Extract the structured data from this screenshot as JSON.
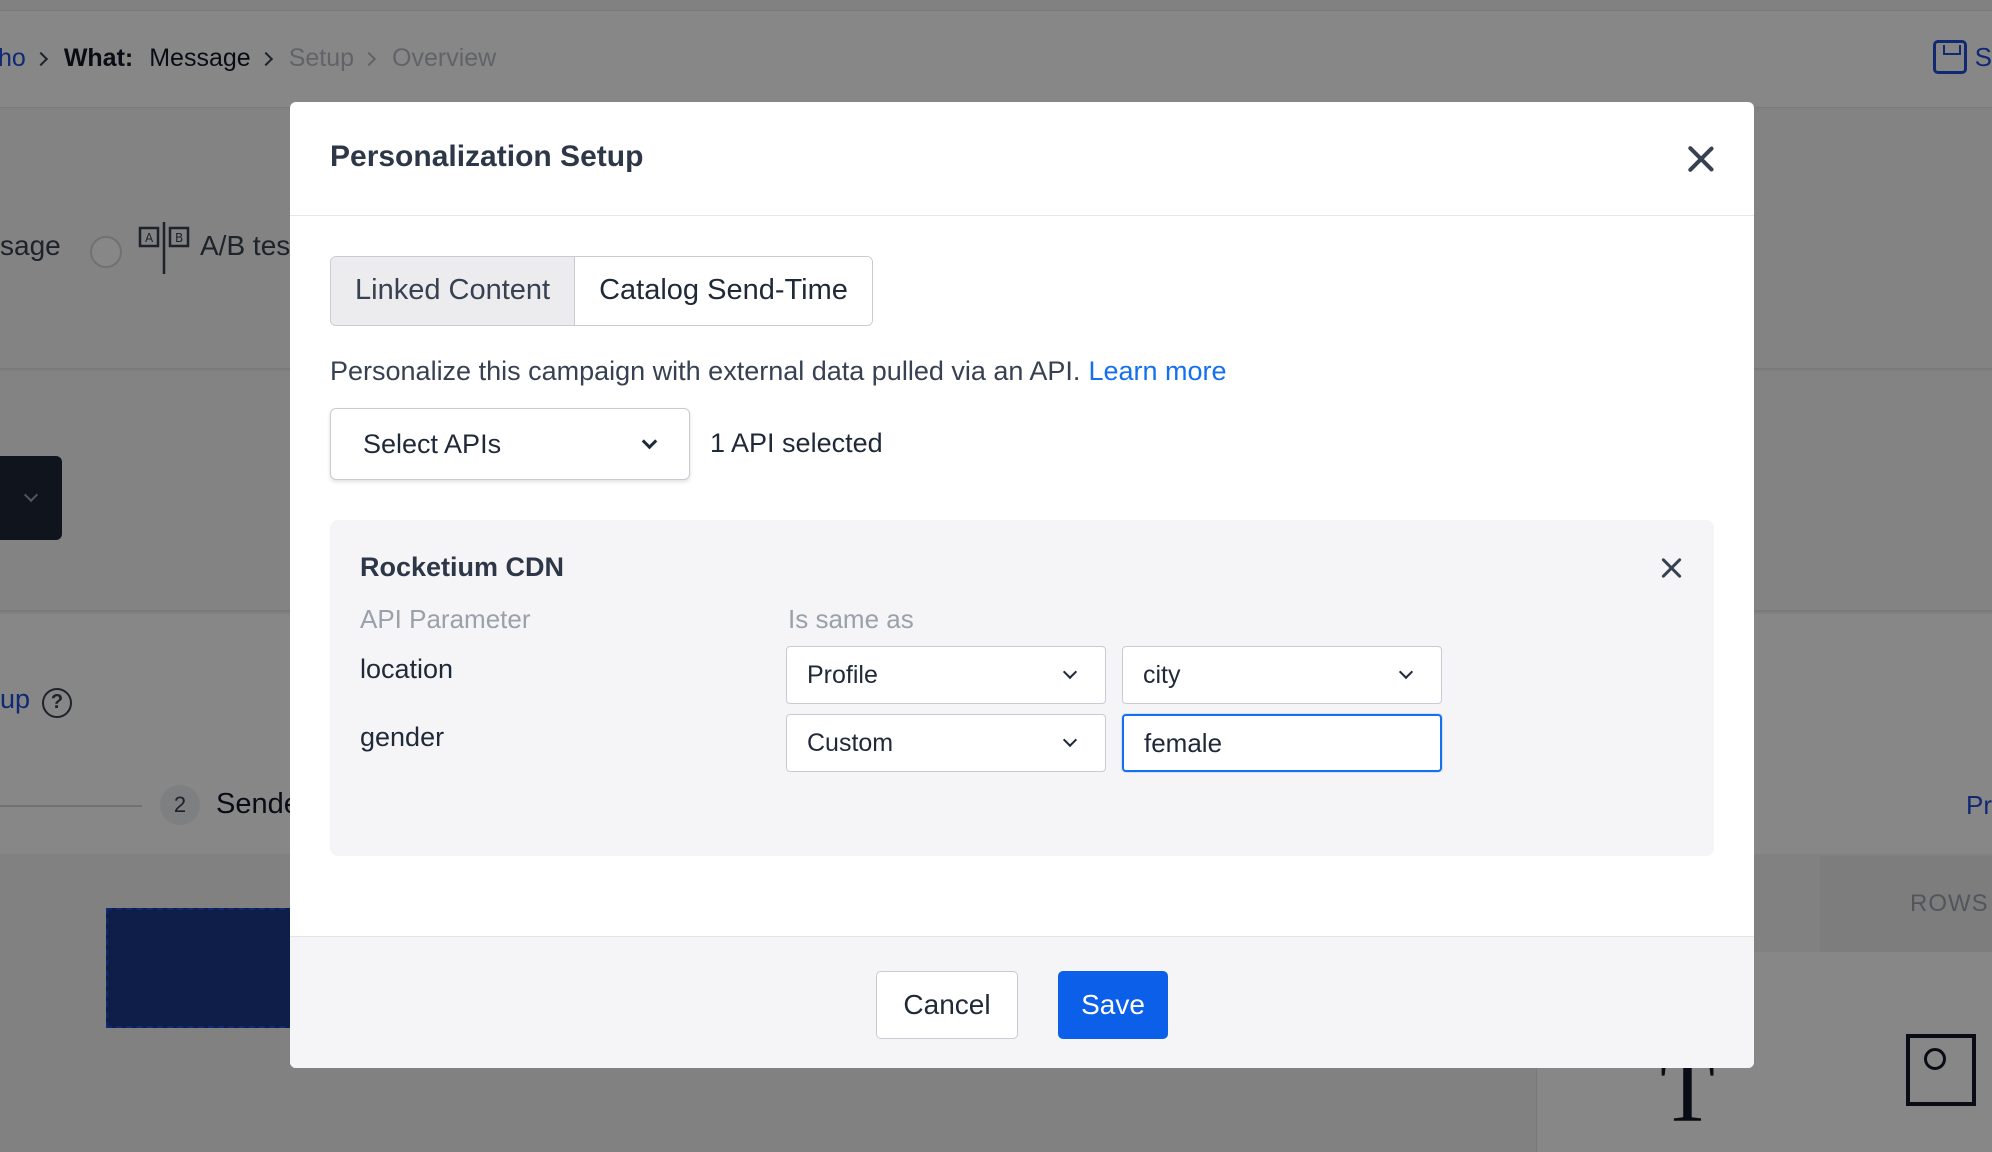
{
  "background": {
    "breadcrumb": {
      "who": "ho",
      "what_label": "What:",
      "what_value": "Message",
      "setup": "Setup",
      "overview": "Overview"
    },
    "save_partial": "S",
    "message_tab": "sage",
    "ab_test": "A/B tes",
    "setup_link": "up",
    "help_icon": "?",
    "step_number": "2",
    "step_label": "Sende",
    "preview_partial": "Pr",
    "rows_label": "ROWS",
    "text_glyph": "T"
  },
  "modal": {
    "title": "Personalization Setup",
    "tabs": [
      {
        "label": "Linked Content",
        "active": true
      },
      {
        "label": "Catalog Send-Time",
        "active": false
      }
    ],
    "description": "Personalize this campaign with external data pulled via an API.",
    "learn_more": "Learn more",
    "select_apis": {
      "label": "Select APIs"
    },
    "api_count": "1 API selected",
    "api_card": {
      "title": "Rocketium CDN",
      "col_param": "API Parameter",
      "col_same_as": "Is same as",
      "rows": [
        {
          "param": "location",
          "source": "Profile",
          "value": "city",
          "value_type": "dropdown"
        },
        {
          "param": "gender",
          "source": "Custom",
          "value": "female",
          "value_type": "input"
        }
      ]
    },
    "footer": {
      "cancel": "Cancel",
      "save": "Save"
    }
  },
  "colors": {
    "primary": "#0b5fe8",
    "link": "#1570ef",
    "overlay": "rgba(0,0,0,0.47)"
  }
}
